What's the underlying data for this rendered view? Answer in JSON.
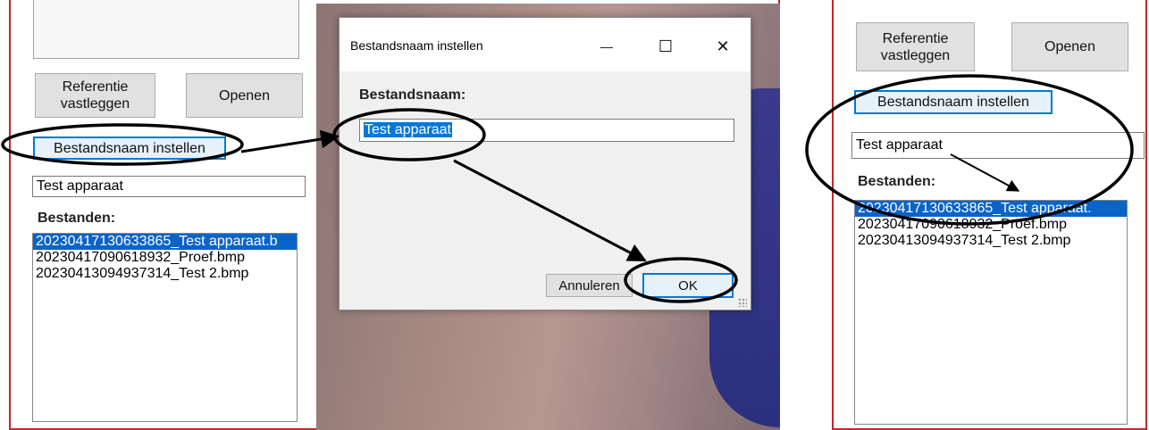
{
  "left_form": {
    "reference_button": "Referentie\nvastleggen",
    "open_button": "Openen",
    "set_filename_button": "Bestandsnaam instellen",
    "filename_field": "Test apparaat",
    "files_label": "Bestanden:",
    "files": [
      "20230417130633865_Test apparaat.b",
      "20230417090618932_Proef.bmp",
      "20230413094937314_Test 2.bmp"
    ]
  },
  "dialog": {
    "title": "Bestandsnaam instellen",
    "minimize_glyph": "—",
    "maximize_glyph": "☐",
    "close_glyph": "✕",
    "field_label": "Bestandsnaam:",
    "field_value": "Test apparaat",
    "cancel_button": "Annuleren",
    "ok_button": "OK"
  },
  "right_form": {
    "reference_button": "Referentie\nvastleggen",
    "open_button": "Openen",
    "set_filename_button": "Bestandsnaam instellen",
    "filename_field": "Test apparaat",
    "files_label": "Bestanden:",
    "files": [
      "20230417130633865_Test apparaat.",
      "20230417090618932_Proef.bmp",
      "20230413094937314_Test 2.bmp"
    ]
  },
  "colors": {
    "panel_border": "#c0282d",
    "selection": "#0a64c8",
    "annotation": "#000000"
  }
}
